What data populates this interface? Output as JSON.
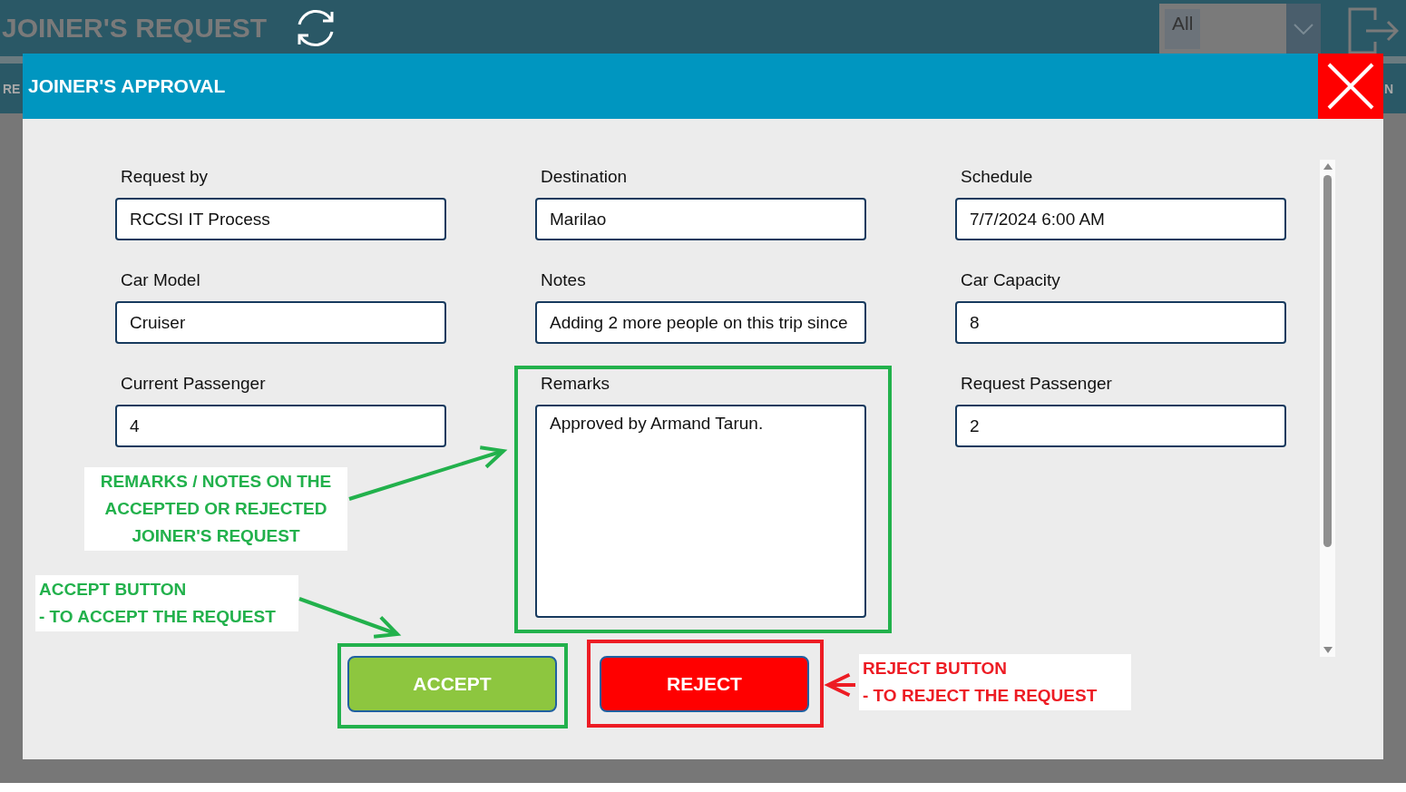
{
  "app": {
    "title": "JOINER'S REQUEST",
    "filter": {
      "value": "All"
    },
    "left_tab_fragment": "RE",
    "right_tab_fragment": "N"
  },
  "dialog": {
    "title": "JOINER'S APPROVAL",
    "fields": [
      {
        "label": "Request by",
        "value": "RCCSI IT Process",
        "kind": "text"
      },
      {
        "label": "Destination",
        "value": "Marilao",
        "kind": "text"
      },
      {
        "label": "Schedule",
        "value": "7/7/2024 6:00 AM",
        "kind": "text"
      },
      {
        "label": "Car Model",
        "value": "Cruiser",
        "kind": "text"
      },
      {
        "label": "Notes",
        "value": "Adding 2 more people on this trip since",
        "kind": "text"
      },
      {
        "label": "Car Capacity",
        "value": "8",
        "kind": "text"
      },
      {
        "label": "Current Passenger",
        "value": "4",
        "kind": "text"
      },
      {
        "label": "Remarks",
        "value": "Approved by Armand Tarun.",
        "kind": "textarea"
      },
      {
        "label": "Request Passenger",
        "value": "2",
        "kind": "text"
      }
    ],
    "buttons": [
      {
        "label": "ACCEPT",
        "kind": "accept"
      },
      {
        "label": "REJECT",
        "kind": "reject"
      }
    ]
  },
  "annotations": [
    {
      "lines": [
        "REMARKS / NOTES ON THE",
        "ACCEPTED OR REJECTED",
        "JOINER'S REQUEST"
      ],
      "color": "#22b14c"
    },
    {
      "lines": [
        "ACCEPT BUTTON",
        "- TO ACCEPT THE REQUEST"
      ],
      "color": "#22b14c"
    },
    {
      "lines": [
        "REJECT BUTTON",
        "- TO REJECT THE REQUEST"
      ],
      "color": "#ed1c24"
    }
  ]
}
